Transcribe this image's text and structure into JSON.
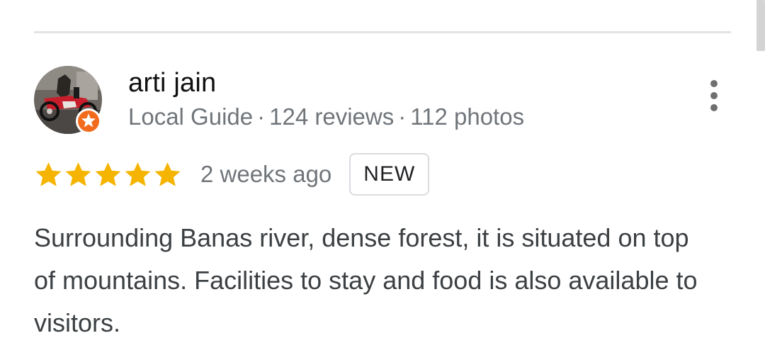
{
  "reviewer": {
    "name": "arti jain",
    "badge": "Local Guide",
    "reviews": "124 reviews",
    "photos": "112 photos",
    "separator": "·"
  },
  "review": {
    "rating": 5,
    "max_rating": 5,
    "date": "2 weeks ago",
    "new_label": "NEW",
    "text": "Surrounding Banas river, dense forest, it is situated on top of mountains. Facilities to stay and food is also available to visitors."
  },
  "icons": {
    "more": "more-vert-icon",
    "star": "star-icon",
    "local_guide": "local-guide-badge-icon"
  },
  "colors": {
    "star": "#F5B400",
    "badge_orange": "#F26B1D",
    "meta_text": "#70757A",
    "body_text": "#3C4043"
  }
}
